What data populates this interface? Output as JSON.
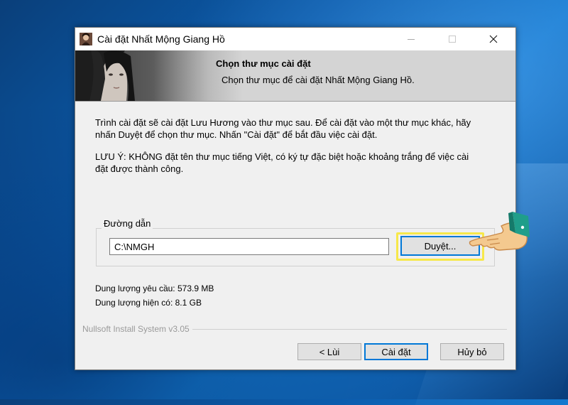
{
  "window": {
    "title": "Cài đặt Nhất Mộng Giang Hồ",
    "minimize_icon": "minimize-icon",
    "maximize_icon": "maximize-icon",
    "close_icon": "close-icon"
  },
  "header": {
    "title": "Chọn thư mục cài đặt",
    "subtitle": "Chọn thư mục để cài đặt Nhất Mộng Giang Hồ."
  },
  "content": {
    "intro_line1": "Trình cài đặt sẽ cài đặt Lưu Hương vào thư mục sau. Để cài đặt vào một thư mục khác, hãy",
    "intro_line2": "nhấn Duyệt để chọn thư mục. Nhấn \"Cài đặt\" để bắt đầu việc cài đặt.",
    "note_line1": "LƯU Ý: KHÔNG đặt tên thư mục tiếng Việt, có ký tự đặc biệt hoặc khoảng trắng để việc cài",
    "note_line2": "đặt được thành công."
  },
  "destination": {
    "group_label": "Đường dẫn",
    "path_value": "C:\\NMGH",
    "browse_label": "Duyệt..."
  },
  "space": {
    "required": "Dung lượng yêu cầu: 573.9 MB",
    "available": "Dung lượng hiện có: 8.1 GB"
  },
  "footer": {
    "branding": "Nullsoft Install System v3.05",
    "back_label": "< Lùi",
    "install_label": "Cài đặt",
    "cancel_label": "Hủy bỏ"
  },
  "colors": {
    "accent": "#0078d7",
    "highlight": "#f7e84a",
    "desktop": "#0b5cad"
  }
}
